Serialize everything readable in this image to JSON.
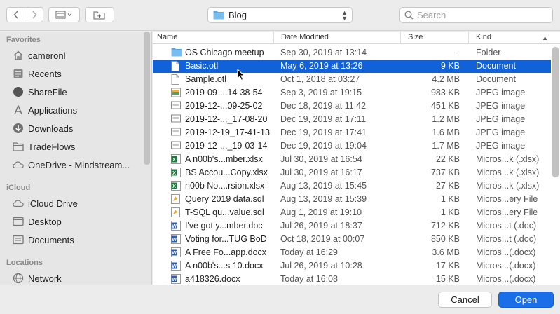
{
  "toolbar": {
    "location": "Blog",
    "search_placeholder": "Search"
  },
  "sidebar": {
    "favorites_heading": "Favorites",
    "favorites": [
      {
        "label": "cameronl",
        "icon": "home-icon"
      },
      {
        "label": "Recents",
        "icon": "clock-icon"
      },
      {
        "label": "ShareFile",
        "icon": "sharefile-icon"
      },
      {
        "label": "Applications",
        "icon": "applications-icon"
      },
      {
        "label": "Downloads",
        "icon": "download-icon"
      },
      {
        "label": "TradeFlows",
        "icon": "folder-icon"
      },
      {
        "label": "OneDrive - Mindstream...",
        "icon": "cloud-icon"
      }
    ],
    "icloud_heading": "iCloud",
    "icloud": [
      {
        "label": "iCloud Drive",
        "icon": "cloud-icon"
      },
      {
        "label": "Desktop",
        "icon": "desktop-icon"
      },
      {
        "label": "Documents",
        "icon": "document-icon"
      }
    ],
    "locations_heading": "Locations",
    "locations": [
      {
        "label": "Network",
        "icon": "globe-icon"
      }
    ]
  },
  "columns": {
    "name": "Name",
    "date": "Date Modified",
    "size": "Size",
    "kind": "Kind"
  },
  "files": [
    {
      "name": "OS Chicago meetup",
      "date": "Sep 30, 2019 at 13:14",
      "size": "--",
      "kind": "Folder",
      "type": "folder"
    },
    {
      "name": "Basic.otl",
      "date": "May 6, 2019 at 13:26",
      "size": "9 KB",
      "kind": "Document",
      "type": "doc",
      "selected": true
    },
    {
      "name": "Sample.otl",
      "date": "Oct 1, 2018 at 03:27",
      "size": "4.2 MB",
      "kind": "Document",
      "type": "doc"
    },
    {
      "name": "2019-09-...14-38-54",
      "date": "Sep 3, 2019 at 19:15",
      "size": "983 KB",
      "kind": "JPEG image",
      "type": "jpg-color"
    },
    {
      "name": "2019-12-...09-25-02",
      "date": "Dec 18, 2019 at 11:42",
      "size": "451 KB",
      "kind": "JPEG image",
      "type": "jpg"
    },
    {
      "name": "2019-12-..._17-08-20",
      "date": "Dec 19, 2019 at 17:11",
      "size": "1.2 MB",
      "kind": "JPEG image",
      "type": "jpg"
    },
    {
      "name": "2019-12-19_17-41-13",
      "date": "Dec 19, 2019 at 17:41",
      "size": "1.6 MB",
      "kind": "JPEG image",
      "type": "jpg"
    },
    {
      "name": "2019-12-..._19-03-14",
      "date": "Dec 19, 2019 at 19:04",
      "size": "1.7 MB",
      "kind": "JPEG image",
      "type": "jpg"
    },
    {
      "name": "A  n00b's...mber.xlsx",
      "date": "Jul 30, 2019 at 16:54",
      "size": "22 KB",
      "kind": "Micros...k (.xlsx)",
      "type": "xlsx"
    },
    {
      "name": "BS Accou...Copy.xlsx",
      "date": "Jul 30, 2019 at 16:17",
      "size": "737 KB",
      "kind": "Micros...k (.xlsx)",
      "type": "xlsx"
    },
    {
      "name": "n00b No....rsion.xlsx",
      "date": "Aug 13, 2019 at 15:45",
      "size": "27 KB",
      "kind": "Micros...k (.xlsx)",
      "type": "xlsx"
    },
    {
      "name": "Query 2019 data.sql",
      "date": "Aug 13, 2019 at 15:39",
      "size": "1 KB",
      "kind": "Micros...ery File",
      "type": "sql"
    },
    {
      "name": "T-SQL qu...value.sql",
      "date": "Aug 1, 2019 at 19:10",
      "size": "1 KB",
      "kind": "Micros...ery File",
      "type": "sql"
    },
    {
      "name": "I've got y...mber.doc",
      "date": "Jul 26, 2019 at 18:37",
      "size": "712 KB",
      "kind": "Micros...t (.doc)",
      "type": "word"
    },
    {
      "name": "Voting for...TUG BoD",
      "date": "Oct 18, 2019 at 00:07",
      "size": "850 KB",
      "kind": "Micros...t (.doc)",
      "type": "word"
    },
    {
      "name": "A Free Fo...app.docx",
      "date": "Today at 16:29",
      "size": "3.6 MB",
      "kind": "Micros...(.docx)",
      "type": "word"
    },
    {
      "name": "A n00b's...s 10.docx",
      "date": "Jul 26, 2019 at 10:28",
      "size": "17 KB",
      "kind": "Micros...(.docx)",
      "type": "word"
    },
    {
      "name": "a418326.docx",
      "date": "Today at 16:08",
      "size": "15 KB",
      "kind": "Micros...(.docx)",
      "type": "word"
    }
  ],
  "footer": {
    "cancel_label": "Cancel",
    "open_label": "Open"
  },
  "colors": {
    "selection": "#1162d8",
    "primary_button": "#1a6ee8",
    "folder_blue": "#5aa9e6",
    "excel_green": "#1f7a3f",
    "word_blue": "#2b5fb5"
  }
}
